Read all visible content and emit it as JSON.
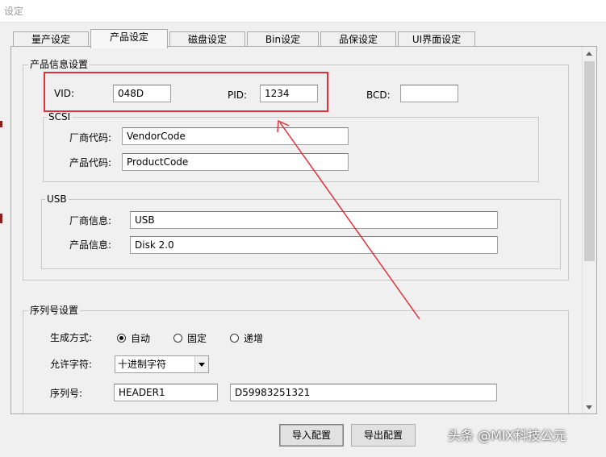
{
  "window": {
    "title": "设定"
  },
  "tabs": [
    {
      "label": "量产设定",
      "active": false
    },
    {
      "label": "产品设定",
      "active": true
    },
    {
      "label": "磁盘设定",
      "active": false
    },
    {
      "label": "Bin设定",
      "active": false
    },
    {
      "label": "品保设定",
      "active": false
    },
    {
      "label": "UI界面设定",
      "active": false
    }
  ],
  "product_info": {
    "group_label": "产品信息设置",
    "vid_label": "VID:",
    "vid_value": "048D",
    "pid_label": "PID:",
    "pid_value": "1234",
    "bcd_label": "BCD:",
    "bcd_value": ""
  },
  "scsi": {
    "group_label": "SCSI",
    "vendor_label": "厂商代码:",
    "vendor_value": "VendorCode",
    "product_label": "产品代码:",
    "product_value": "ProductCode"
  },
  "usb": {
    "group_label": "USB",
    "vendor_label": "厂商信息:",
    "vendor_value": "USB",
    "product_label": "产品信息:",
    "product_value": "Disk 2.0"
  },
  "serial": {
    "group_label": "序列号设置",
    "mode_label": "生成方式:",
    "modes": [
      {
        "label": "自动",
        "selected": true
      },
      {
        "label": "固定",
        "selected": false
      },
      {
        "label": "递增",
        "selected": false
      }
    ],
    "charset_label": "允许字符:",
    "charset_value": "十进制字符",
    "serial_label": "序列号:",
    "prefix_value": "HEADER1",
    "serial_value": "D59983251321"
  },
  "buttons": {
    "import_label": "导入配置",
    "export_label": "导出配置"
  },
  "watermark": {
    "text": "头条 @MIX科技公元"
  },
  "colors": {
    "highlight": "#e0303a",
    "background": "#f0f0f0"
  }
}
